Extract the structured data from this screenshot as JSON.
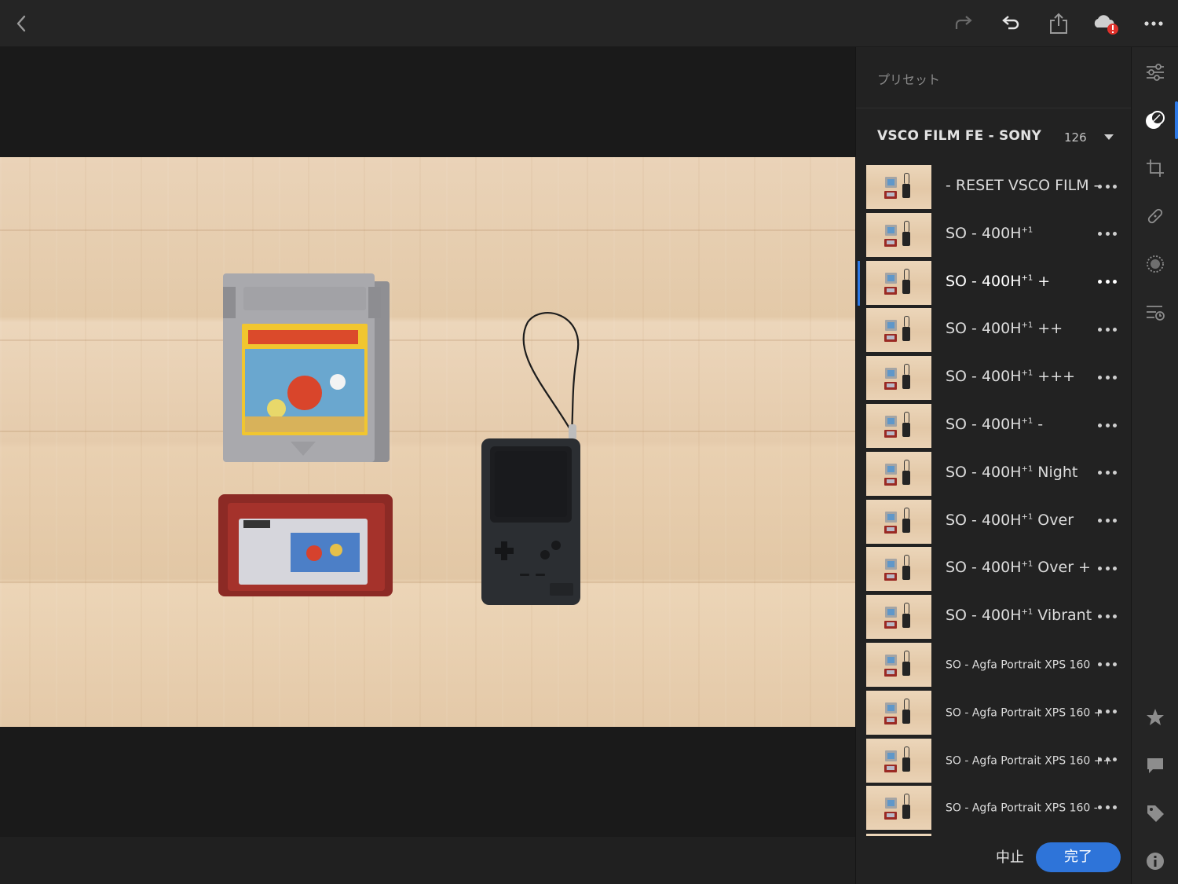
{
  "topbar": {
    "icons": [
      "back-icon",
      "redo-icon",
      "undo-icon",
      "share-icon",
      "cloud-error-icon",
      "more-icon"
    ]
  },
  "presets_panel": {
    "title": "プリセット",
    "group": {
      "name": "VSCO FILM FE - SONY",
      "count": "126"
    },
    "items": [
      {
        "name": "- RESET VSCO FILM -",
        "sup": "",
        "suffix": "",
        "size": "large",
        "selected": false
      },
      {
        "name": "SO - 400H",
        "sup": "+1",
        "suffix": "",
        "size": "large",
        "selected": false
      },
      {
        "name": "SO - 400H",
        "sup": "+1",
        "suffix": " +",
        "size": "large",
        "selected": true
      },
      {
        "name": "SO - 400H",
        "sup": "+1",
        "suffix": " ++",
        "size": "large",
        "selected": false
      },
      {
        "name": "SO - 400H",
        "sup": "+1",
        "suffix": " +++",
        "size": "large",
        "selected": false
      },
      {
        "name": "SO - 400H",
        "sup": "+1",
        "suffix": " -",
        "size": "large",
        "selected": false
      },
      {
        "name": "SO - 400H",
        "sup": "+1",
        "suffix": " Night",
        "size": "large",
        "selected": false
      },
      {
        "name": "SO - 400H",
        "sup": "+1",
        "suffix": " Over",
        "size": "large",
        "selected": false
      },
      {
        "name": "SO - 400H",
        "sup": "+1",
        "suffix": " Over +",
        "size": "large",
        "selected": false
      },
      {
        "name": "SO - 400H",
        "sup": "+1",
        "suffix": " Vibrant",
        "size": "large",
        "selected": false
      },
      {
        "name": "SO - Agfa Portrait XPS 160",
        "sup": "",
        "suffix": "",
        "size": "small",
        "selected": false
      },
      {
        "name": "SO - Agfa Portrait XPS 160 +",
        "sup": "",
        "suffix": "",
        "size": "small",
        "selected": false
      },
      {
        "name": "SO - Agfa Portrait XPS 160 ++",
        "sup": "",
        "suffix": "",
        "size": "small",
        "selected": false
      },
      {
        "name": "SO - Agfa Portrait XPS 160 -",
        "sup": "",
        "suffix": "",
        "size": "small",
        "selected": false
      }
    ],
    "cancel_label": "中止",
    "done_label": "完了"
  },
  "toolstrip": {
    "tools": [
      "edit-sliders-icon",
      "presets-icon",
      "crop-icon",
      "healing-icon",
      "selective-icon",
      "versions-icon"
    ],
    "bottom_tools": [
      "star-icon",
      "comment-icon",
      "tag-icon",
      "info-icon"
    ],
    "active": "presets-icon"
  },
  "colors": {
    "accent": "#2d79e6",
    "done_button": "#2e74d9",
    "error": "#e0312b"
  }
}
